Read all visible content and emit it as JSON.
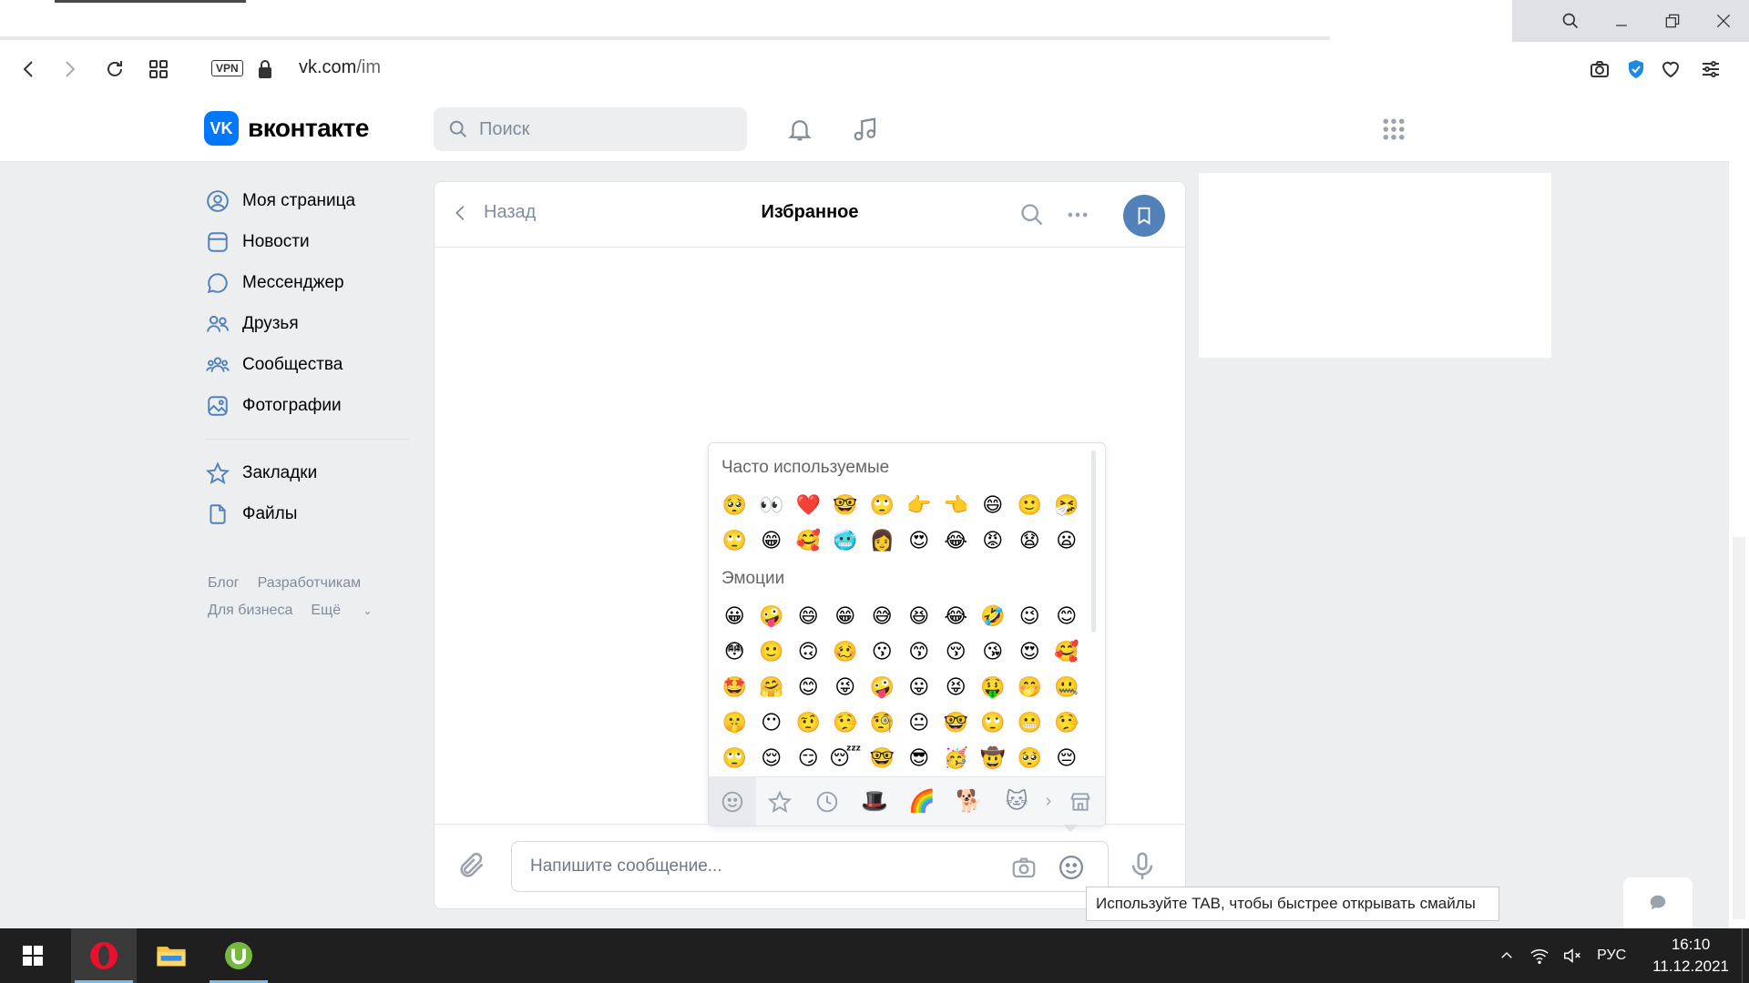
{
  "browser": {
    "url_host": "vk.com",
    "url_path": "/im",
    "vpn_label": "VPN"
  },
  "vk": {
    "logo_letter": "VK",
    "logo_text": "вконтакте",
    "search_placeholder": "Поиск",
    "menu": [
      {
        "label": "Моя страница",
        "icon": "user-circle-icon"
      },
      {
        "label": "Новости",
        "icon": "news-icon"
      },
      {
        "label": "Мессенджер",
        "icon": "message-icon"
      },
      {
        "label": "Друзья",
        "icon": "friends-icon"
      },
      {
        "label": "Сообщества",
        "icon": "communities-icon"
      },
      {
        "label": "Фотографии",
        "icon": "photos-icon"
      },
      {
        "label": "Закладки",
        "icon": "star-icon"
      },
      {
        "label": "Файлы",
        "icon": "file-icon"
      }
    ],
    "footer": {
      "blog": "Блог",
      "developers": "Разработчикам",
      "business": "Для бизнеса",
      "more": "Ещё"
    }
  },
  "chat": {
    "back_label": "Назад",
    "title": "Избранное",
    "input_placeholder": "Напишите сообщение..."
  },
  "emoji_picker": {
    "frequent_title": "Часто используемые",
    "frequent": [
      "🥺",
      "👀",
      "❤️",
      "🤓",
      "🙄",
      "👉",
      "👈",
      "😄",
      "🙂",
      "🤧",
      "🙄",
      "😁",
      "🥰",
      "🥶",
      "👩",
      "😍",
      "😂",
      "😡",
      "😧",
      "😦"
    ],
    "emotions_title": "Эмоции",
    "emotions": [
      "😀",
      "🤪",
      "😄",
      "😁",
      "😅",
      "😆",
      "😂",
      "🤣",
      "😉",
      "😊",
      "😳",
      "🙂",
      "🙃",
      "🥴",
      "😗",
      "😙",
      "😚",
      "😘",
      "😍",
      "🥰",
      "🤩",
      "🤗",
      "😊",
      "😜",
      "🤪",
      "😛",
      "😝",
      "🤑",
      "🤭",
      "🤐",
      "🤫",
      "😶",
      "🤨",
      "🤥",
      "🧐",
      "😐",
      "🤓",
      "🙄",
      "😬",
      "🤥",
      "🙄",
      "😌",
      "😏",
      "😴",
      "🤓",
      "😎",
      "🥳",
      "🤠",
      "🥺",
      "😔"
    ],
    "tabs": [
      "smile-icon",
      "star-icon",
      "clock-icon",
      "🎩",
      "🌈",
      "🐕",
      "🐱"
    ],
    "store_icon": "store-icon"
  },
  "tooltip": "Используйте TAB, чтобы быстрее открывать смайлы",
  "taskbar": {
    "language": "РУС",
    "time": "16:10",
    "date": "11.12.2021"
  },
  "colors": {
    "vk_blue": "#0077ff",
    "accent": "#5181b8",
    "background": "#edeef0"
  }
}
